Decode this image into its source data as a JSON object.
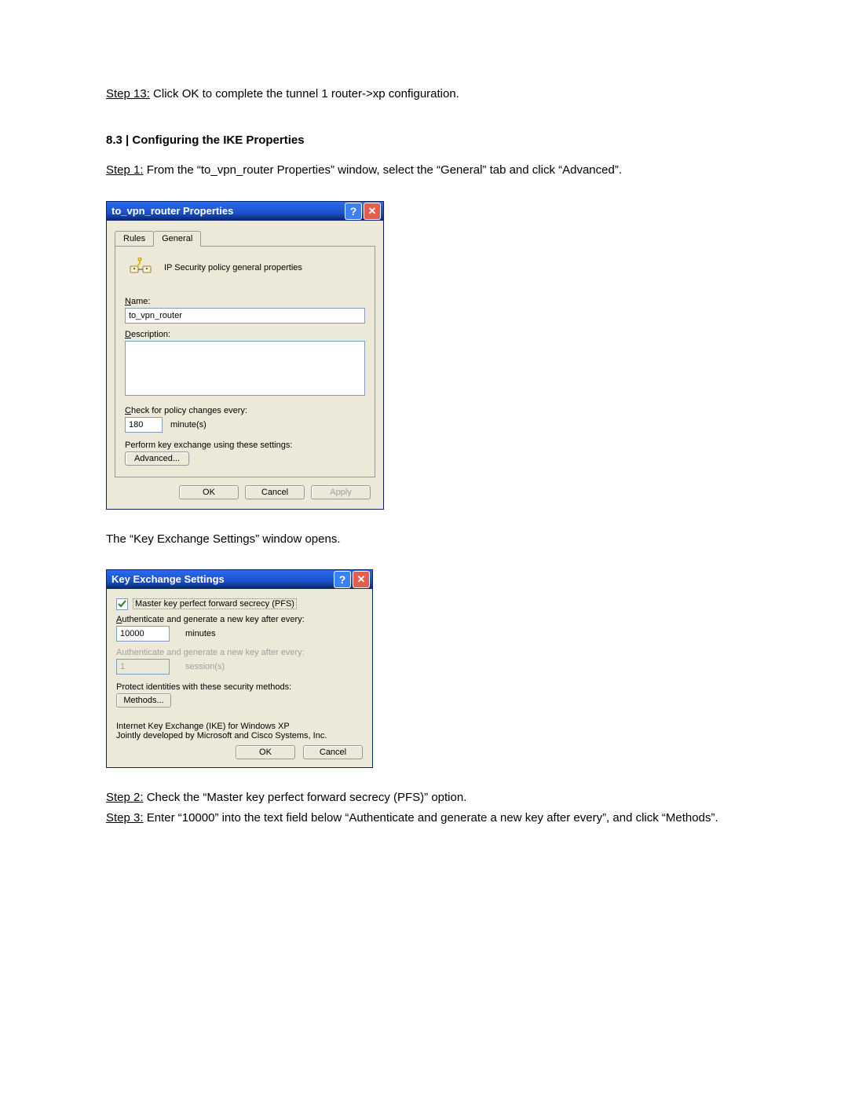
{
  "doc": {
    "step13_label": "Step 13:",
    "step13_text": " Click OK to complete the tunnel 1 router->xp configuration.",
    "section_heading": "8.3 | Configuring the IKE Properties",
    "step1_label": "Step 1:",
    "step1_text": " From the “to_vpn_router Properties” window, select the “General” tab and click “Advanced”.",
    "kes_opens": "The “Key Exchange Settings” window opens.",
    "step2_label": "Step 2:",
    "step2_text": " Check the “Master key perfect forward secrecy (PFS)” option.",
    "step3_label": "Step 3:",
    "step3_text": " Enter “10000” into the text field below “Authenticate and generate a new key after every”, and click “Methods”."
  },
  "dlg1": {
    "title": "to_vpn_router Properties",
    "tabs": {
      "rules": "Rules",
      "general": "General"
    },
    "icon_caption": "IP Security policy general properties",
    "name_label_pre": "N",
    "name_label": "ame:",
    "name_value": "to_vpn_router",
    "desc_label_pre": "D",
    "desc_label": "escription:",
    "check_label_pre": "C",
    "check_label": "heck for policy changes every:",
    "check_value": "180",
    "check_unit": "minute(s)",
    "perform_text": "Perform key exchange using these settings:",
    "advanced_btn_pre": "Ad",
    "advanced_btn_u": "v",
    "advanced_btn_post": "anced...",
    "ok": "OK",
    "cancel": "Cancel",
    "apply_pre": "A",
    "apply": "pply"
  },
  "dlg2": {
    "title": "Key Exchange Settings",
    "pfs_text": "Master key perfect forward secrecy (PFS)",
    "pfs_u": "M",
    "auth_min_label": "Authenticate and generate a new key after every:",
    "auth_min_u": "A",
    "auth_min_value": "10000",
    "auth_min_unit": "minutes",
    "auth_sess_label": "Authenticate and generate a new key after every:",
    "auth_sess_value": "1",
    "auth_sess_unit": "session(s)",
    "protect_label": "Protect identities with these security methods:",
    "methods_btn": "Methods...",
    "methods_u": "M",
    "info1": "Internet Key Exchange (IKE) for Windows XP",
    "info2": "Jointly developed by Microsoft and Cisco Systems, Inc.",
    "ok": "OK",
    "cancel": "Cancel"
  },
  "icons": {
    "help": "?",
    "close": "✕"
  }
}
